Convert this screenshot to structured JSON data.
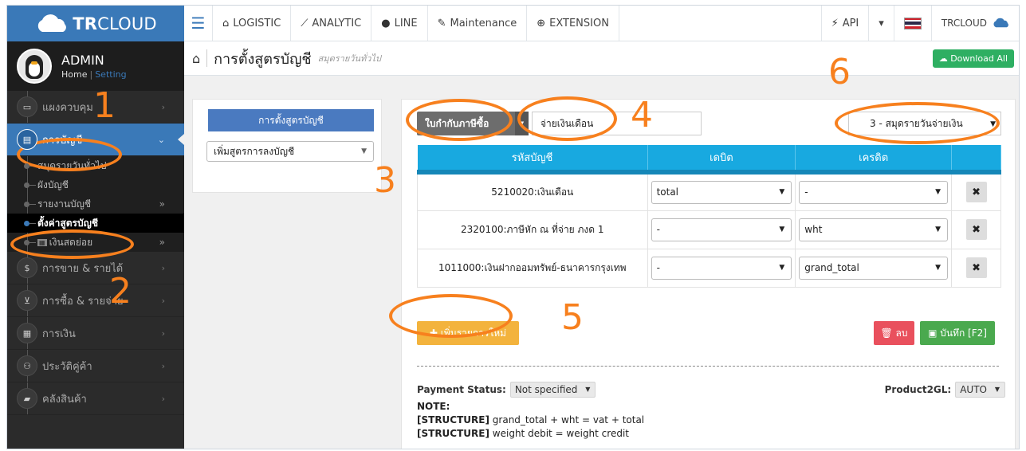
{
  "brand": {
    "logo_bold": "TR",
    "logo_rest": "CLOUD",
    "logo_icon": "cloud-icon"
  },
  "topnav": {
    "menu_icon": "hamburger-icon",
    "items": [
      {
        "label": "LOGISTIC",
        "icon": "bank-icon"
      },
      {
        "label": "ANALYTIC",
        "icon": "chart-icon"
      },
      {
        "label": "LINE",
        "icon": "chat-icon"
      },
      {
        "label": "Maintenance",
        "icon": "wrench-icon"
      },
      {
        "label": "EXTENSION",
        "icon": "plus-circle-icon"
      }
    ],
    "api_label": "API",
    "account_label": "TRCLOUD"
  },
  "user": {
    "name": "ADMIN",
    "home": "Home",
    "setting": "Setting"
  },
  "sidebar": {
    "items": [
      {
        "label": "แผงควบคุม"
      },
      {
        "label": "การบัญชี",
        "active": true
      },
      {
        "label": "การขาย & รายได้"
      },
      {
        "label": "การซื้อ & รายจ่าย"
      },
      {
        "label": "การเงิน"
      },
      {
        "label": "ประวัติคู่ค้า"
      },
      {
        "label": "คลังสินค้า"
      }
    ],
    "subitems": [
      {
        "label": "สมุดรายวันทั่วไป"
      },
      {
        "label": "ผังบัญชี"
      },
      {
        "label": "รายงานบัญชี"
      },
      {
        "label": "ตั้งค่าสูตรบัญชี",
        "current": true
      },
      {
        "label": "เงินสดย่อย"
      }
    ]
  },
  "page": {
    "title": "การตั้งสูตรบัญชี",
    "subtitle": "สมุดรายวันทั่วไป",
    "download_label": "Download All"
  },
  "leftpanel": {
    "header": "การตั้งสูตรบัญชี",
    "select_value": "เพิ่มสูตรการลงบัญชี"
  },
  "form": {
    "type_label": "ใบกำกับภาษีซื้อ",
    "name_value": "จ่ายเงินเดือน",
    "book_value": "3 - สมุดรายวันจ่ายเงิน",
    "columns": {
      "account": "รหัสบัญชี",
      "debit": "เดบิต",
      "credit": "เครดิต"
    },
    "rows": [
      {
        "account": "5210020:เงินเดือน",
        "debit": "total",
        "credit": "-"
      },
      {
        "account": "2320100:ภาษีหัก ณ ที่จ่าย ภงด 1",
        "debit": "-",
        "credit": "wht"
      },
      {
        "account": "1011000:เงินฝากออมทรัพย์-ธนาคารกรุงเทพ",
        "debit": "-",
        "credit": "grand_total"
      }
    ],
    "add_label": "เพิ่มรายการใหม่",
    "delete_label": "ลบ",
    "save_label": "บันทึก [F2]",
    "payment_status_label": "Payment Status:",
    "payment_status_value": "Not specified",
    "product2gl_label": "Product2GL:",
    "product2gl_value": "AUTO",
    "note_label": "NOTE:",
    "structure_tag": "[STRUCTURE]",
    "structure_1": "grand_total + wht = vat + total",
    "structure_2": "weight debit = weight credit"
  },
  "annotations": [
    "1",
    "2",
    "3",
    "4",
    "5",
    "6"
  ],
  "colors": {
    "accent": "#3a79b8",
    "annotation": "#f7801e",
    "table_header": "#18a9e0"
  }
}
